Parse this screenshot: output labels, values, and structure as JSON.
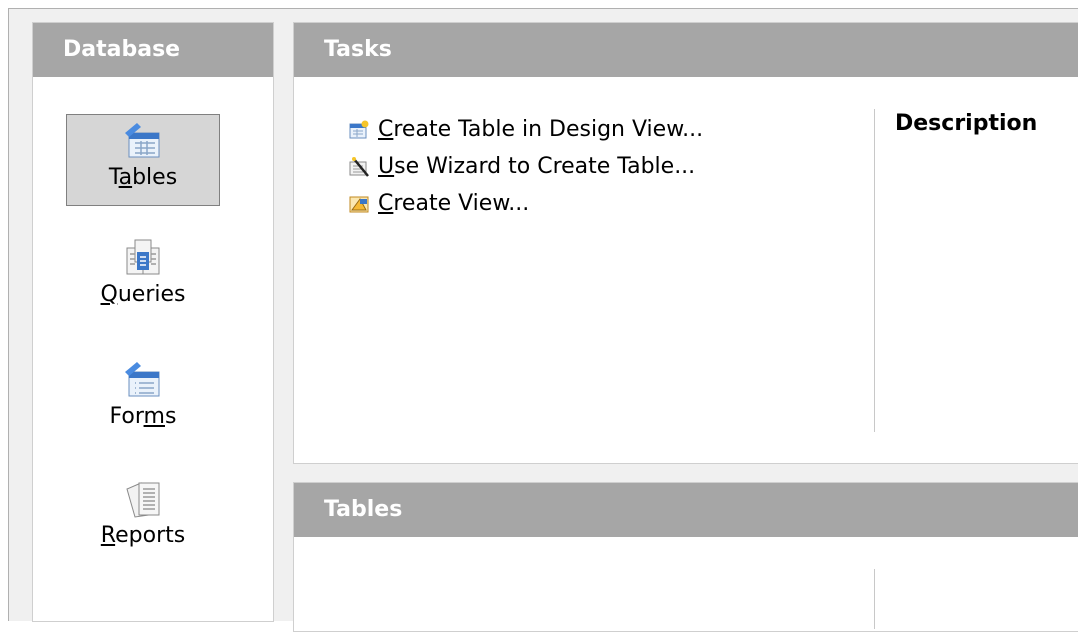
{
  "database_pane": {
    "title": "Database",
    "items": [
      {
        "pre": "T",
        "u": "a",
        "post": "bles",
        "icon": "tables-icon",
        "selected": true
      },
      {
        "pre": "",
        "u": "Q",
        "post": "ueries",
        "icon": "queries-icon",
        "selected": false
      },
      {
        "pre": "For",
        "u": "m",
        "post": "s",
        "icon": "forms-icon",
        "selected": false
      },
      {
        "pre": "",
        "u": "R",
        "post": "eports",
        "icon": "reports-icon",
        "selected": false
      }
    ]
  },
  "tasks_panel": {
    "title": "Tasks",
    "tasks": [
      {
        "u": "C",
        "post": "reate Table in Design View...",
        "icon": "design-view-icon"
      },
      {
        "u": "U",
        "post": "se Wizard to Create Table...",
        "icon": "wizard-icon"
      },
      {
        "u": "C",
        "post": "reate View...",
        "icon": "create-view-icon"
      }
    ],
    "description_label": "Description"
  },
  "tables_panel": {
    "title": "Tables"
  }
}
